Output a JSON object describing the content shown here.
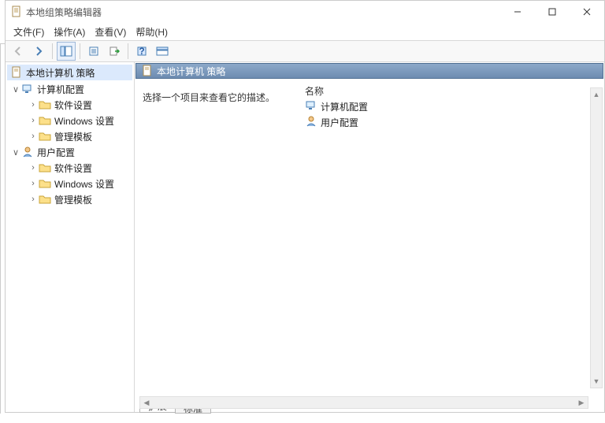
{
  "window": {
    "title": "本地组策略编辑器"
  },
  "menu": {
    "file": "文件(F)",
    "action": "操作(A)",
    "view": "查看(V)",
    "help": "帮助(H)"
  },
  "tree": {
    "root": "本地计算机 策略",
    "computer": {
      "label": "计算机配置",
      "software": "软件设置",
      "windows": "Windows 设置",
      "admin": "管理模板"
    },
    "user": {
      "label": "用户配置",
      "software": "软件设置",
      "windows": "Windows 设置",
      "admin": "管理模板"
    }
  },
  "main": {
    "header": "本地计算机 策略",
    "description": "选择一个项目来查看它的描述。",
    "column_name": "名称",
    "items": {
      "computer": "计算机配置",
      "user": "用户配置"
    }
  },
  "tabs": {
    "extended": "扩展",
    "standard": "标准"
  }
}
